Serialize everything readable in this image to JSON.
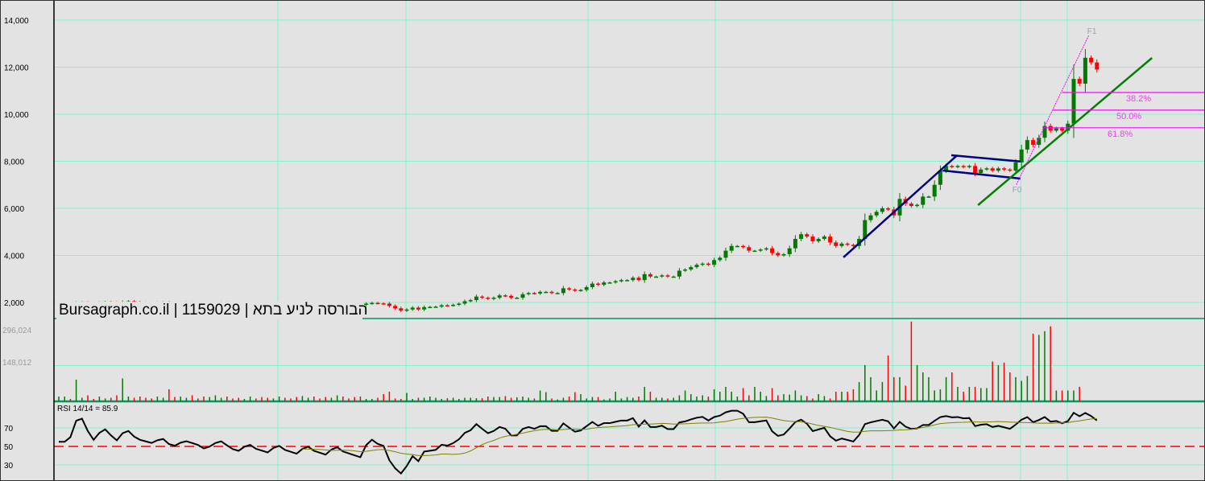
{
  "watermark": "Bursagraph.co.il | 1159029 | הבורסה לניע בתא",
  "colors": {
    "background": "#e3e3e3",
    "grid": "#7ff5c8",
    "up": "#007a00",
    "down": "#ff0000",
    "channel": "#000080",
    "trendline": "#008000",
    "fib": "#ff00ff",
    "rsi_line": "#000000",
    "rsi_signal": "#808000",
    "rsi_mid": "#ff0000"
  },
  "chart_data": [
    {
      "type": "candlestick",
      "title": "",
      "ylim": [
        1000,
        14500
      ],
      "y_ticks": [
        {
          "value": 14000,
          "label": "14,000"
        },
        {
          "value": 12000,
          "label": "12,000"
        },
        {
          "value": 10000,
          "label": "10,000"
        },
        {
          "value": 8000,
          "label": "8,000"
        },
        {
          "value": 6000,
          "label": "6,000"
        },
        {
          "value": 4000,
          "label": "4,000"
        },
        {
          "value": 2000,
          "label": "2,000"
        }
      ],
      "closes": [
        1950,
        1980,
        1960,
        2000,
        2010,
        1990,
        1970,
        2000,
        2020,
        2000,
        1980,
        2030,
        2050,
        2020,
        2000,
        1990,
        1980,
        2000,
        2010,
        1980,
        1970,
        1990,
        2000,
        1990,
        1980,
        1960,
        1970,
        1990,
        2000,
        1980,
        1960,
        1950,
        1970,
        1980,
        1960,
        1950,
        1940,
        1960,
        1970,
        1950,
        1940,
        1930,
        1950,
        1960,
        1940,
        1930,
        1920,
        1940,
        1950,
        1930,
        1920,
        1910,
        1900,
        1950,
        1980,
        1960,
        1950,
        1850,
        1750,
        1650,
        1700,
        1780,
        1700,
        1800,
        1810,
        1820,
        1880,
        1870,
        1900,
        1950,
        2050,
        2100,
        2250,
        2200,
        2150,
        2200,
        2300,
        2280,
        2200,
        2200,
        2350,
        2400,
        2380,
        2450,
        2450,
        2400,
        2400,
        2600,
        2550,
        2500,
        2530,
        2650,
        2800,
        2750,
        2850,
        2850,
        2900,
        2950,
        2950,
        3050,
        2950,
        3200,
        3100,
        3100,
        3150,
        3100,
        3100,
        3350,
        3400,
        3500,
        3600,
        3650,
        3600,
        3800,
        3900,
        4200,
        4400,
        4400,
        4350,
        4200,
        4200,
        4250,
        4300,
        4100,
        4000,
        4050,
        4300,
        4700,
        4900,
        4800,
        4600,
        4700,
        4800,
        4550,
        4400,
        4500,
        4450,
        4400,
        4700,
        5500,
        5700,
        5850,
        6000,
        5950,
        5700,
        6400,
        6200,
        6100,
        6150,
        6500,
        6500,
        7000,
        7600,
        7800,
        7750,
        7800,
        7750,
        7800,
        7500,
        7650,
        7700,
        7600,
        7700,
        7650,
        7600,
        7950,
        8500,
        8900,
        8700,
        9000,
        9500,
        9300,
        9400,
        9300,
        9600,
        11500,
        11300,
        12400,
        12200,
        11900
      ],
      "annotations": {
        "channel_lines": [
          {
            "from": [
              135.3,
              3915
            ],
            "to": [
              154.9,
              8256
            ]
          },
          {
            "from": [
              153.9,
              8256
            ],
            "to": [
              165.8,
              7990
            ]
          },
          {
            "from": [
              152.4,
              7607
            ],
            "to": [
              165.8,
              7265
            ]
          }
        ],
        "trendline": {
          "from": [
            158.5,
            6137
          ],
          "to": [
            188.5,
            12393
          ]
        },
        "fibonacci": {
          "f0": {
            "index": 165.1,
            "price": 7000,
            "label": "F0"
          },
          "f1": {
            "index": 177.6,
            "price": 13350,
            "label": "F1"
          },
          "levels": [
            {
              "ratio": 0.382,
              "price": 10924,
              "label": "38.2%",
              "start_index": 173
            },
            {
              "ratio": 0.5,
              "price": 10175,
              "label": "50.0%",
              "start_index": 171.4
            },
            {
              "ratio": 0.618,
              "price": 9426,
              "label": "61.8%",
              "start_index": 169.7
            }
          ]
        }
      }
    },
    {
      "type": "bar",
      "title": "Volume",
      "y_ticks": [
        {
          "value": 296024,
          "label": "296,024"
        },
        {
          "value": 148012,
          "label": "148,012"
        }
      ],
      "values_thousands": [
        20,
        20,
        10,
        90,
        15,
        25,
        10,
        20,
        12,
        15,
        25,
        95,
        20,
        15,
        20,
        15,
        12,
        20,
        15,
        50,
        18,
        20,
        15,
        25,
        12,
        20,
        18,
        25,
        15,
        20,
        12,
        15,
        10,
        20,
        12,
        18,
        15,
        12,
        20,
        15,
        12,
        18,
        22,
        15,
        20,
        12,
        18,
        15,
        25,
        20,
        12,
        18,
        20,
        10,
        10,
        15,
        30,
        40,
        12,
        10,
        35,
        10,
        15,
        15,
        20,
        15,
        10,
        13,
        15,
        10,
        15,
        15,
        13,
        13,
        20,
        18,
        18,
        22,
        15,
        17,
        20,
        15,
        12,
        45,
        38,
        12,
        8,
        15,
        20,
        38,
        30,
        12,
        18,
        18,
        8,
        12,
        40,
        12,
        18,
        15,
        20,
        60,
        40,
        15,
        15,
        12,
        15,
        25,
        45,
        30,
        20,
        25,
        20,
        50,
        40,
        60,
        40,
        20,
        55,
        25,
        60,
        40,
        22,
        55,
        25,
        30,
        28,
        45,
        25,
        22,
        12,
        30,
        22,
        12,
        40,
        40,
        40,
        50,
        80,
        150,
        100,
        45,
        80,
        190,
        100,
        100,
        65,
        330,
        150,
        120,
        100,
        45,
        50,
        100,
        120,
        60,
        40,
        60,
        60,
        55,
        55,
        165,
        150,
        160,
        120,
        100,
        85,
        105,
        280,
        275,
        290,
        310,
        45,
        45,
        45,
        45,
        60
      ]
    },
    {
      "type": "line",
      "title": "RSI",
      "label": "RSI 14/14 = 85.9",
      "period": 14,
      "signal_period": 14,
      "ylim": [
        0,
        100
      ],
      "y_ticks": [
        {
          "value": 70,
          "label": "70"
        },
        {
          "value": 50,
          "label": "50"
        },
        {
          "value": 30,
          "label": "30"
        }
      ],
      "current_value": 85.9
    }
  ]
}
